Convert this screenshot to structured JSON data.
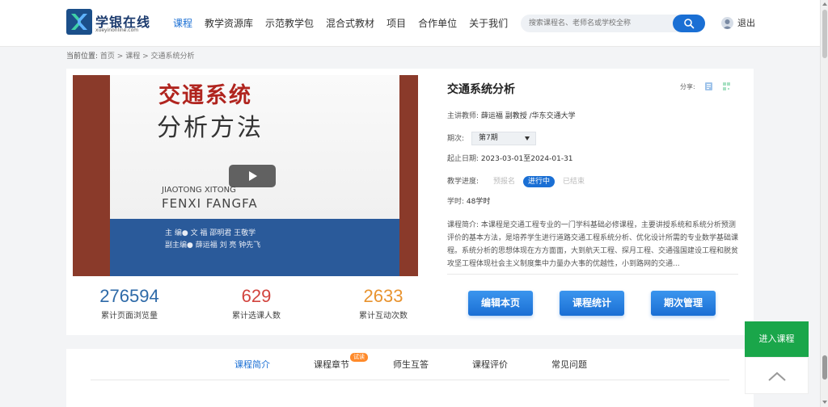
{
  "header": {
    "logo_cn": "学银在线",
    "logo_en": "xueyinonline.com",
    "nav": [
      "课程",
      "教学资源库",
      "示范教学包",
      "混合式教材",
      "项目",
      "合作单位",
      "关于我们"
    ],
    "search_placeholder": "搜索课程名、老师名或学校全称",
    "logout": "退出"
  },
  "breadcrumb": {
    "label": "当前位置:",
    "items": [
      "首页",
      "课程",
      "交通系统分析"
    ],
    "sep": " > "
  },
  "video": {
    "book_title1": "交通系统",
    "book_title2": "分析方法",
    "book_pinyin1": "JIAOTONG XITONG",
    "book_pinyin2": "FENXI FANGFA",
    "book_author1": "主 编● 文 福  邵明君  王敬学",
    "book_author2": "副主编● 薛运福  刘 亮  钟先飞"
  },
  "stats": [
    {
      "value": "276594",
      "label": "累计页面浏览量",
      "color": "#2e6aa8"
    },
    {
      "value": "629",
      "label": "累计选课人数",
      "color": "#d2443e"
    },
    {
      "value": "2633",
      "label": "累计互动次数",
      "color": "#e8932f"
    }
  ],
  "course": {
    "title": "交通系统分析",
    "share_label": "分享:",
    "teacher_label": "主讲教师:",
    "teacher": "薛运福 副教授 /华东交通大学",
    "term_label": "期次:",
    "term": "第7期",
    "deadline_label": "起止日期:",
    "deadline": "2023-03-01至2024-01-31",
    "progress_label": "教学进度:",
    "progress_states": [
      "预报名",
      "进行中",
      "已结束"
    ],
    "progress_active": 1,
    "hours_label": "学时:",
    "hours": "48学时",
    "intro_label": "课程简介:",
    "intro": "本课程是交通工程专业的一门学科基础必修课程，主要讲授系统和系统分析预测评价的基本方法，是培养学生进行道路交通工程系统分析、优化设计所需的专业数学基础课程。系统分析的思想体现在方方面面，大到航天工程、探月工程、交通强国建设工程和脱贫攻坚工程体现社会主义制度集中力量办大事的优越性，小到路网的交通..."
  },
  "actions": [
    "编辑本页",
    "课程统计",
    "期次管理"
  ],
  "tabs": {
    "items": [
      "课程简介",
      "课程章节",
      "师生互答",
      "课程评价",
      "常见问题"
    ],
    "active": 0,
    "badge": "试读"
  },
  "floating": {
    "enter": "进入课程"
  },
  "colors": {
    "primary": "#1a6fd4",
    "green": "#1aa64a"
  }
}
